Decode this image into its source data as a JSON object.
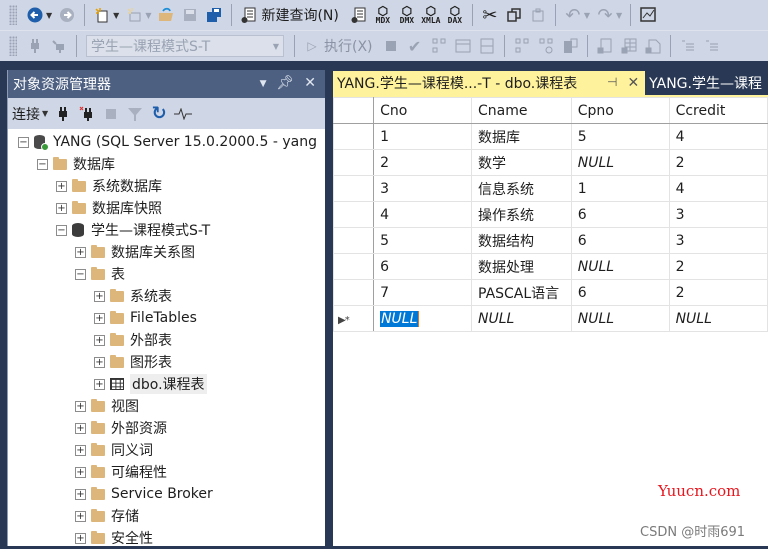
{
  "toolbar1": {
    "new_query_label": "新建查询(N)",
    "icons": [
      "back-icon",
      "forward-icon",
      "new-project-icon",
      "new-file-icon",
      "open-file-icon",
      "save-icon",
      "save-all-icon",
      "new-query-icon",
      "mdx-query-icon",
      "dmx-query-icon",
      "xmla-query-icon",
      "dax-query-icon",
      "cut-icon",
      "copy-icon",
      "paste-icon",
      "undo-icon",
      "redo-icon",
      "activity-monitor-icon"
    ],
    "mini_labels": {
      "mdx": "MDX",
      "dmx": "DMX",
      "xmla": "XMLA",
      "dax": "DAX"
    }
  },
  "toolbar2": {
    "database_selector": "学生—课程模式S-T",
    "execute_label": "执行(X)"
  },
  "object_explorer": {
    "title": "对象资源管理器",
    "connect_label": "连接",
    "tree": [
      {
        "label": "YANG (SQL Server 15.0.2000.5 - yang",
        "type": "server",
        "expanded": true,
        "level": 0
      },
      {
        "label": "数据库",
        "type": "folder",
        "expanded": true,
        "level": 1
      },
      {
        "label": "系统数据库",
        "type": "folder",
        "expanded": false,
        "level": 2
      },
      {
        "label": "数据库快照",
        "type": "folder",
        "expanded": false,
        "level": 2
      },
      {
        "label": "学生—课程模式S-T",
        "type": "database",
        "expanded": true,
        "level": 2
      },
      {
        "label": "数据库关系图",
        "type": "folder",
        "expanded": false,
        "level": 3
      },
      {
        "label": "表",
        "type": "folder",
        "expanded": true,
        "level": 3
      },
      {
        "label": "系统表",
        "type": "folder",
        "expanded": false,
        "level": 4
      },
      {
        "label": "FileTables",
        "type": "folder",
        "expanded": false,
        "level": 4
      },
      {
        "label": "外部表",
        "type": "folder",
        "expanded": false,
        "level": 4
      },
      {
        "label": "图形表",
        "type": "folder",
        "expanded": false,
        "level": 4
      },
      {
        "label": "dbo.课程表",
        "type": "table",
        "expanded": false,
        "level": 4,
        "selected": true
      },
      {
        "label": "视图",
        "type": "folder",
        "expanded": false,
        "level": 3
      },
      {
        "label": "外部资源",
        "type": "folder",
        "expanded": false,
        "level": 3
      },
      {
        "label": "同义词",
        "type": "folder",
        "expanded": false,
        "level": 3
      },
      {
        "label": "可编程性",
        "type": "folder",
        "expanded": false,
        "level": 3
      },
      {
        "label": "Service Broker",
        "type": "folder",
        "expanded": false,
        "level": 3
      },
      {
        "label": "存储",
        "type": "folder",
        "expanded": false,
        "level": 3
      },
      {
        "label": "安全性",
        "type": "folder",
        "expanded": false,
        "level": 3
      }
    ]
  },
  "tabs": [
    {
      "label": "YANG.学生—课程模...-T - dbo.课程表",
      "active": true
    },
    {
      "label": "YANG.学生—课程",
      "active": false
    }
  ],
  "grid": {
    "columns": [
      "Cno",
      "Cname",
      "Cpno",
      "Ccredit"
    ],
    "rows": [
      [
        "1",
        "数据库",
        "5",
        "4"
      ],
      [
        "2",
        "数学",
        "NULL",
        "2"
      ],
      [
        "3",
        "信息系统",
        "1",
        "4"
      ],
      [
        "4",
        "操作系统",
        "6",
        "3"
      ],
      [
        "5",
        "数据结构",
        "6",
        "3"
      ],
      [
        "6",
        "数据处理",
        "NULL",
        "2"
      ],
      [
        "7",
        "PASCAL语言",
        "6",
        "2"
      ]
    ],
    "new_row": [
      "NULL",
      "NULL",
      "NULL",
      "NULL"
    ],
    "new_row_marker": "▶*"
  },
  "watermarks": {
    "site": "Yuucn.com",
    "author": "CSDN @时雨691"
  },
  "colors": {
    "active_tab": "#fff29d",
    "panel_title": "#4d6082",
    "background": "#293955",
    "selection": "#0078d7",
    "watermark_red": "#e8161e"
  }
}
